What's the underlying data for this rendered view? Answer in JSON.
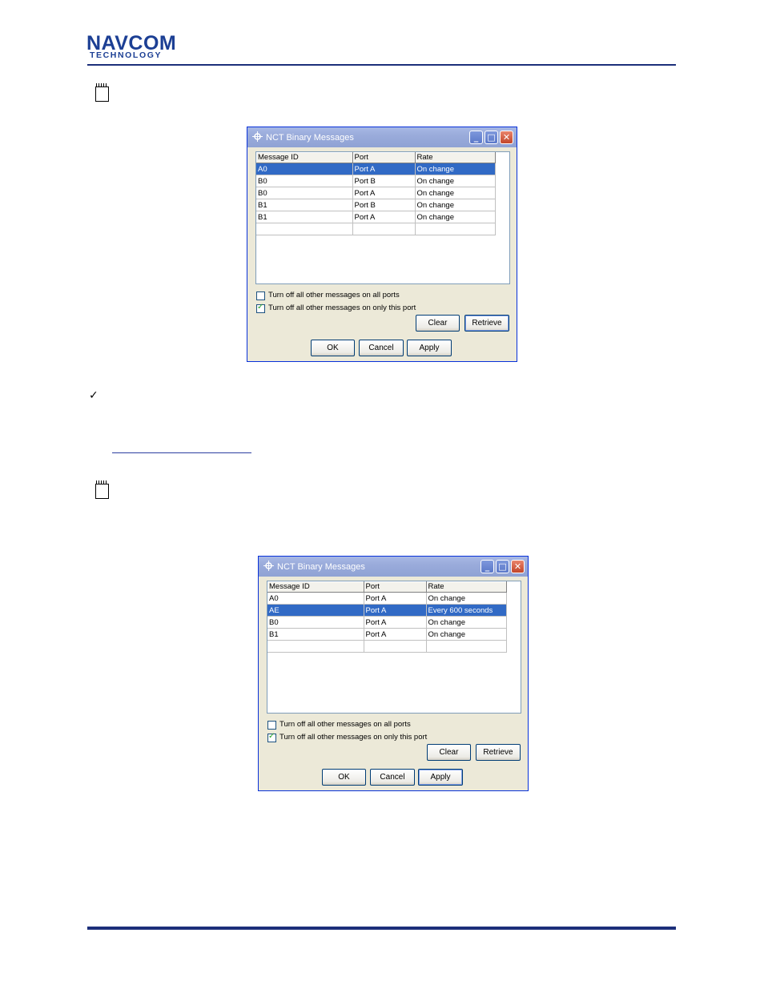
{
  "header": {
    "logo_line1": "NAVCOM",
    "logo_line2": "TECHNOLOGY"
  },
  "colors": {
    "brand": "#1c3f94",
    "selection": "#316ac5",
    "titlebar": "#9aabdb"
  },
  "icons": {
    "note": "notepad-icon",
    "check": "checkmark-icon"
  },
  "checkmark": "✓",
  "dialog1": {
    "title": "NCT Binary Messages",
    "columns": [
      "Message ID",
      "Port",
      "Rate"
    ],
    "rows": [
      [
        "A0",
        "Port A",
        "On change"
      ],
      [
        "B0",
        "Port B",
        "On change"
      ],
      [
        "B0",
        "Port A",
        "On change"
      ],
      [
        "B1",
        "Port B",
        "On change"
      ],
      [
        "B1",
        "Port A",
        "On change"
      ]
    ],
    "selected_row": 0,
    "checkbox_all_ports": "Turn off all other messages on all ports",
    "checkbox_all_ports_checked": false,
    "checkbox_this_port": "Turn off all other messages on only this port",
    "checkbox_this_port_checked": true,
    "clear": "Clear",
    "retrieve": "Retrieve",
    "ok": "OK",
    "cancel": "Cancel",
    "apply": "Apply"
  },
  "dialog2": {
    "title": "NCT Binary Messages",
    "columns": [
      "Message ID",
      "Port",
      "Rate"
    ],
    "rows": [
      [
        "A0",
        "Port A",
        "On change"
      ],
      [
        "AE",
        "Port A",
        "Every 600 seconds"
      ],
      [
        "B0",
        "Port A",
        "On change"
      ],
      [
        "B1",
        "Port A",
        "On change"
      ]
    ],
    "selected_row": 1,
    "checkbox_all_ports": "Turn off all other messages on all ports",
    "checkbox_all_ports_checked": false,
    "checkbox_this_port": "Turn off all other messages on only this port",
    "checkbox_this_port_checked": true,
    "clear": "Clear",
    "retrieve": "Retrieve",
    "ok": "OK",
    "cancel": "Cancel",
    "apply": "Apply"
  }
}
